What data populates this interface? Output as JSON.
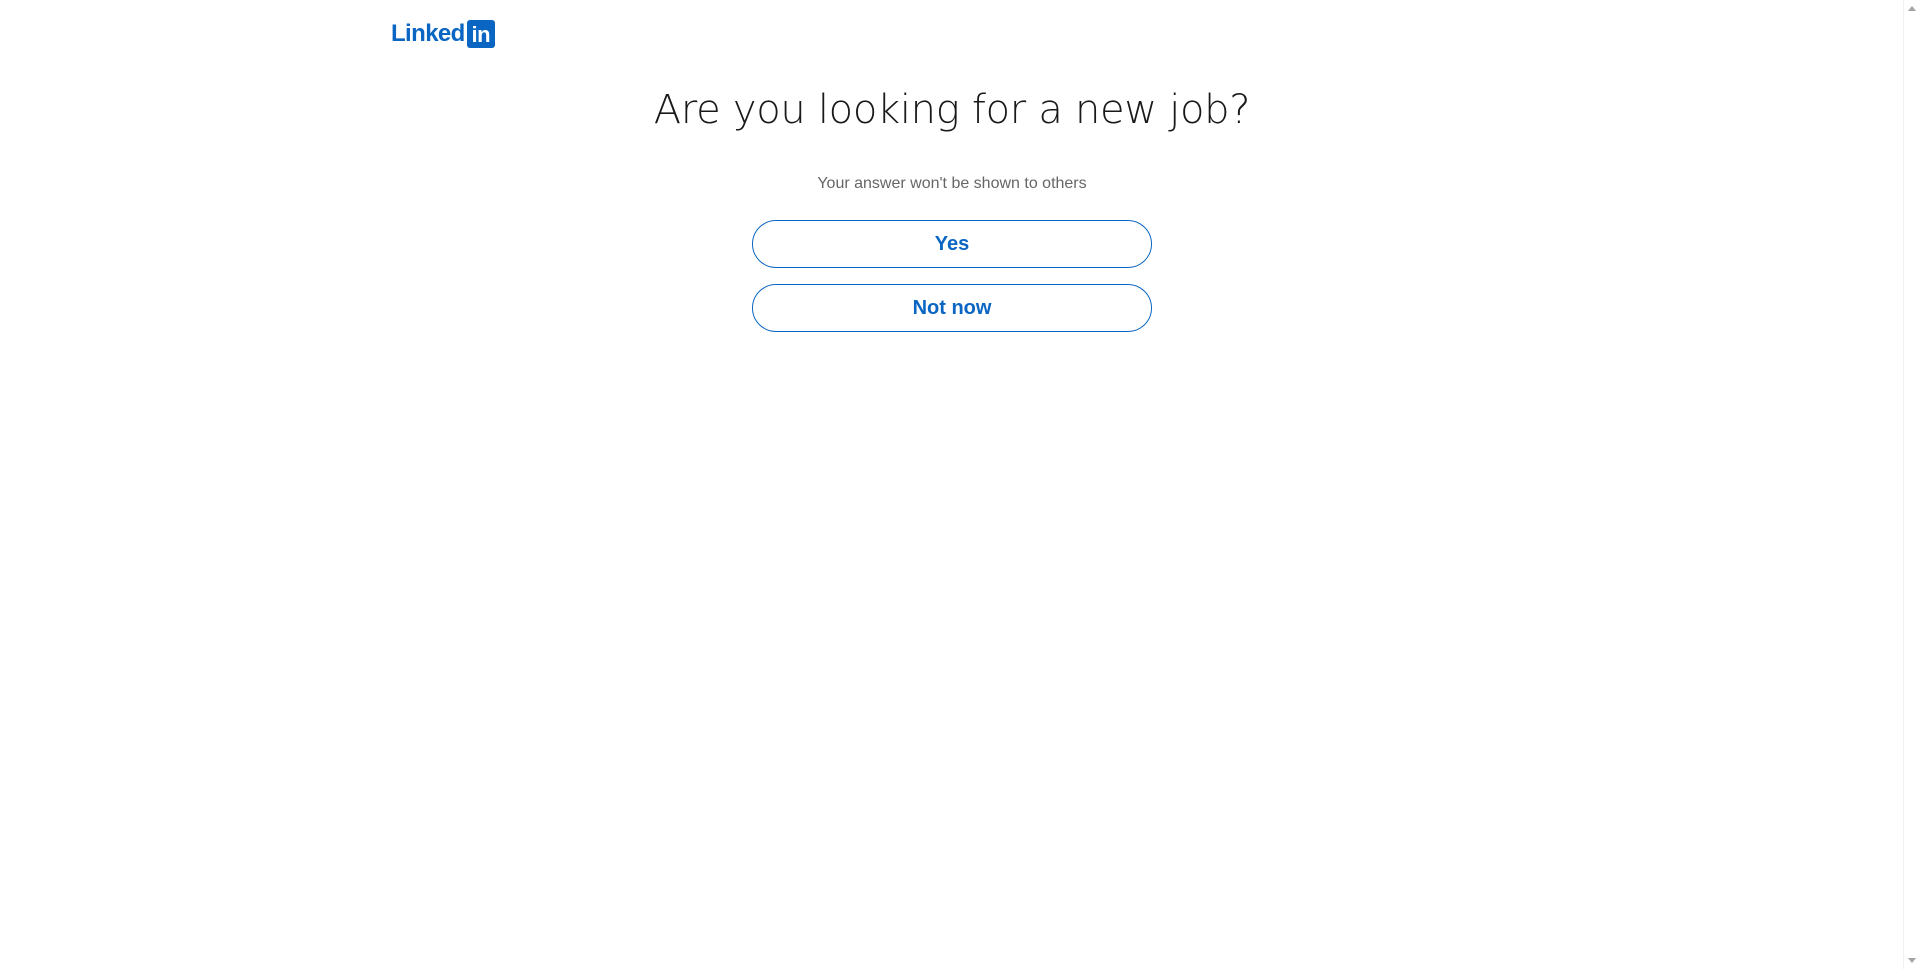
{
  "brand": {
    "word": "Linked",
    "box": "in",
    "color": "#0a66c2"
  },
  "prompt": {
    "headline": "Are you looking for a new job?",
    "subtext": "Your answer won't be shown to others"
  },
  "options": {
    "yes_label": "Yes",
    "not_now_label": "Not now"
  },
  "colors": {
    "accent": "#0a66c2",
    "headline": "#191919",
    "subtext": "#666666",
    "background": "#ffffff"
  }
}
